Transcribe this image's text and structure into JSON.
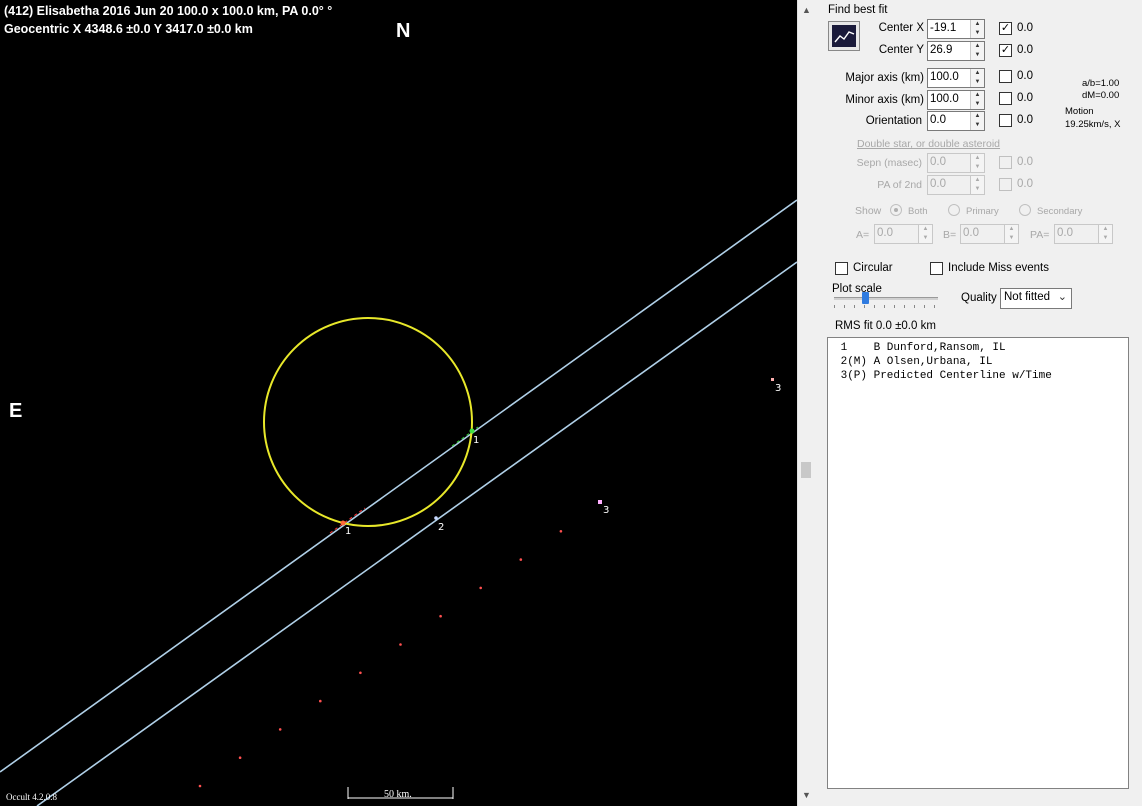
{
  "plot": {
    "header_line1": "(412) Elisabetha  2016 Jun 20   100.0 x 100.0 km, PA 0.0° °",
    "header_line2": "Geocentric  X  4348.6 ±0.0  Y 3417.0 ±0.0 km",
    "north_label": "N",
    "east_label": "E",
    "version": "Occult 4.2.0.8",
    "scale_bar_label": "50 km.",
    "colors": {
      "background": "#000000",
      "ellipse": "#e8e82a",
      "chord_lines": "#b0d0e8",
      "predicted_points": "#ff5050",
      "dis_segment": "#ff3030",
      "rea_segment": "#30d030"
    },
    "chord_labels": {
      "chord1_reappear": "1",
      "chord1_disappear": "1",
      "chord2": "2",
      "predicted_a": "3",
      "predicted_b": "3"
    }
  },
  "panel": {
    "find_best_fit_label": "Find best fit",
    "center_x": {
      "label": "Center X",
      "value": "-19.1",
      "checked": true,
      "fit_value": "0.0"
    },
    "center_y": {
      "label": "Center Y",
      "value": "26.9",
      "checked": true,
      "fit_value": "0.0"
    },
    "major_axis": {
      "label": "Major axis (km)",
      "value": "100.0",
      "checked": false,
      "fit_value": "0.0"
    },
    "minor_axis": {
      "label": "Minor axis (km)",
      "value": "100.0",
      "checked": false,
      "fit_value": "0.0"
    },
    "orientation": {
      "label": "Orientation",
      "value": "0.0",
      "checked": false,
      "fit_value": "0.0"
    },
    "ab_ratio": "a/b=1.00",
    "dm": "dM=0.00",
    "motion_label": "Motion",
    "motion_value": "19.25km/s, X",
    "double_star_link": "Double star, or  double asteroid",
    "sepn": {
      "label": "Sepn (masec)",
      "value": "0.0",
      "fit_value": "0.0"
    },
    "pa_2nd": {
      "label": "PA of 2nd",
      "value": "0.0",
      "fit_value": "0.0"
    },
    "show_label": "Show",
    "show_options": [
      "Both",
      "Primary",
      "Secondary"
    ],
    "a_label": "A=",
    "a_value": "0.0",
    "b_label": "B=",
    "b_value": "0.0",
    "pa_label": "PA=",
    "pa_value": "0.0",
    "circular_label": "Circular",
    "include_miss_label": "Include Miss events",
    "plot_scale_label": "Plot scale",
    "quality_label": "Quality",
    "quality_value": "Not fitted",
    "rms_fit": "RMS fit  0.0 ±0.0 km",
    "observers": [
      " 1    B Dunford,Ransom, IL",
      " 2(M) A Olsen,Urbana, IL",
      " 3(P) Predicted Centerline w/Time"
    ]
  }
}
